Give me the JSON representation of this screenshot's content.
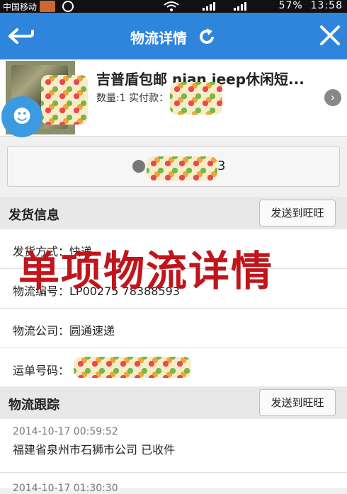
{
  "status_bar": {
    "carrier": "中国移动",
    "battery": "57%",
    "time": "13:58"
  },
  "header": {
    "title": "物流详情",
    "icons": {
      "back": "back-arrow-icon",
      "refresh": "refresh-icon",
      "close": "close-icon"
    }
  },
  "product": {
    "title": "吉普盾包邮 nian jeep休闲短...",
    "qty_label": "数量:1 实付款：",
    "badge_icon": "chat-bubble-icon"
  },
  "tracking_button": {
    "number_suffix": "3"
  },
  "shipping_info": {
    "section_label": "发货信息",
    "send_button": "发送到旺旺",
    "rows": [
      {
        "text": "发货方式：快递"
      },
      {
        "text": "物流编号：LP00275 78388593"
      },
      {
        "text": "物流公司：圆通速递"
      },
      {
        "text": "运单号码："
      }
    ]
  },
  "watermark": "单项物流详情",
  "logistics_tracking": {
    "section_label": "物流跟踪",
    "send_button": "发送到旺旺",
    "entries": [
      {
        "time": "2014-10-17 00:59:52",
        "desc": "福建省泉州市石狮市公司 已收件"
      },
      {
        "time": "2014-10-17 01:30:30",
        "desc": ""
      }
    ]
  },
  "colors": {
    "accent": "#2f84dc",
    "watermark": "#c0151c"
  }
}
